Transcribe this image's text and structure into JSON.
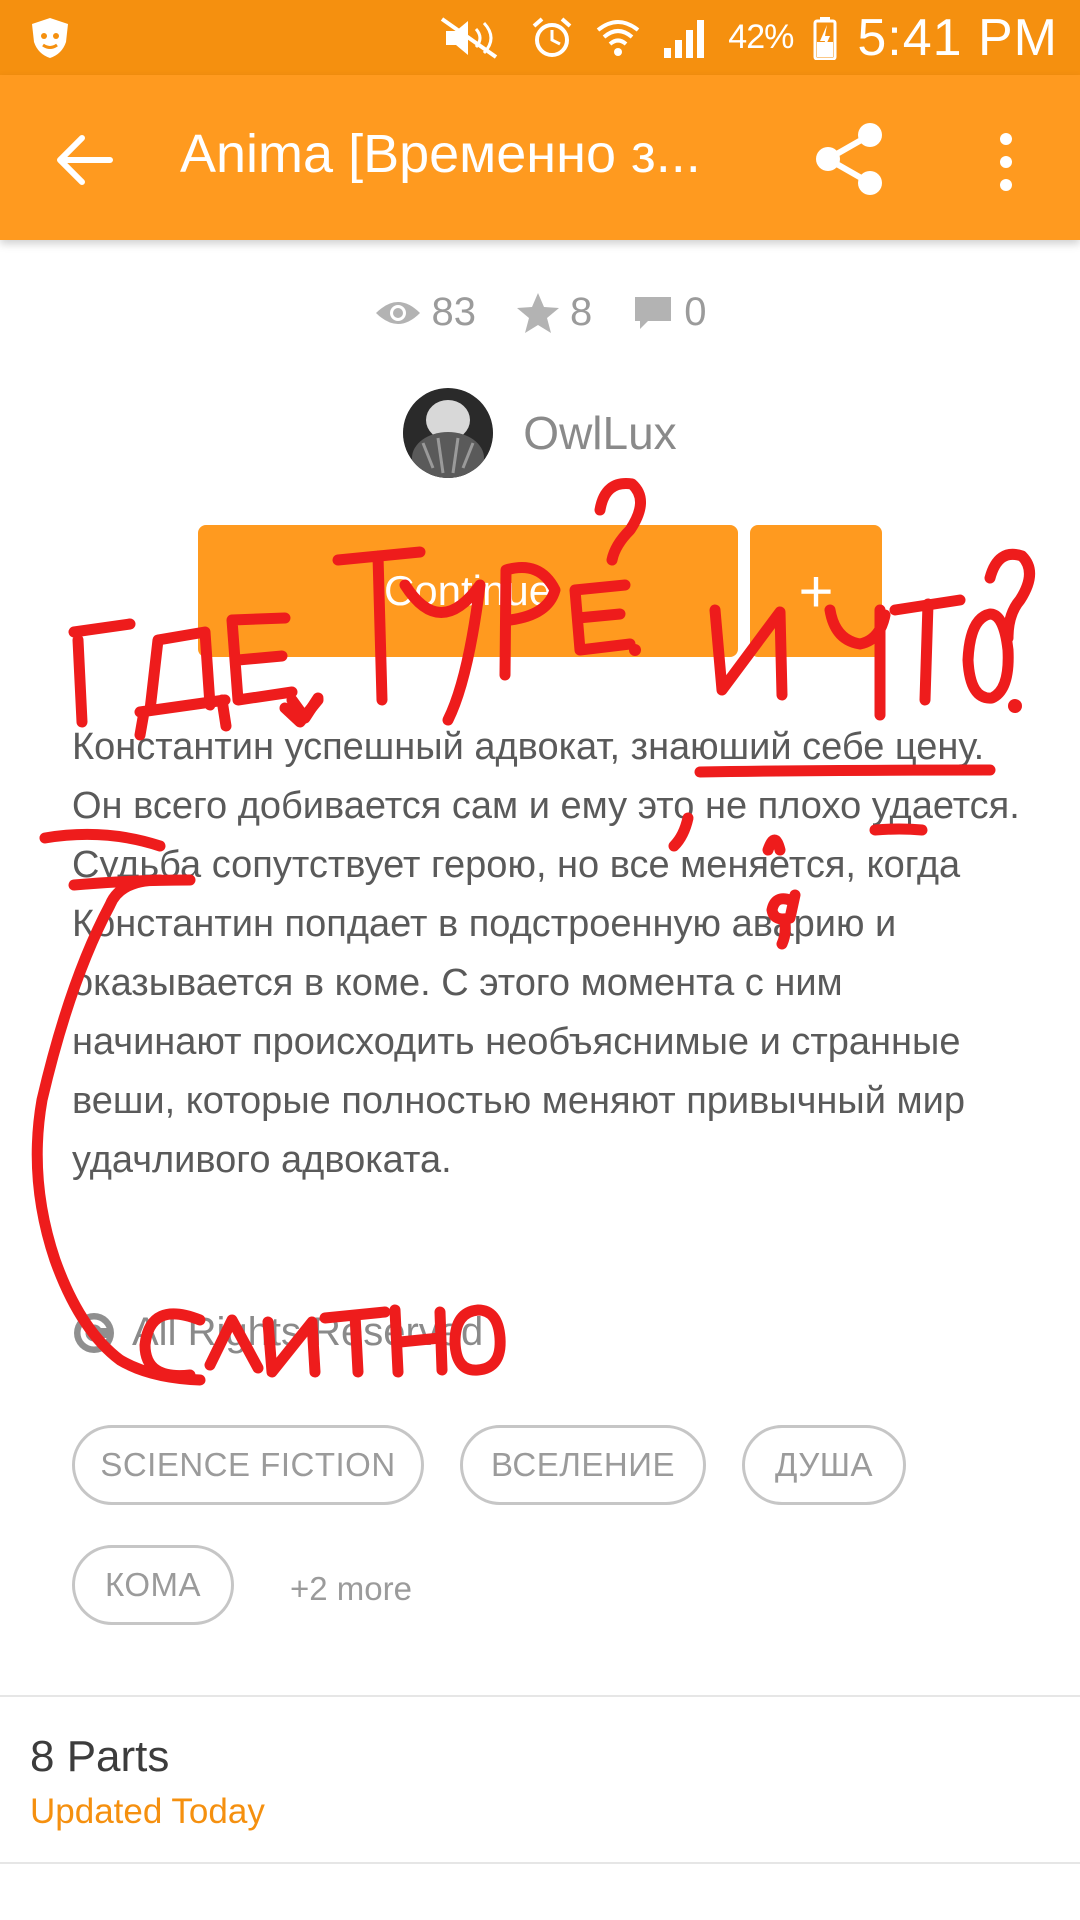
{
  "status_bar": {
    "battery": "42%",
    "time": "5:41 PM"
  },
  "app_bar": {
    "title": "Anima [Временно з...",
    "back_icon": "arrow-left-icon",
    "share_icon": "share-icon",
    "more_icon": "more-vert-icon"
  },
  "stats": {
    "views": "83",
    "votes": "8",
    "comments": "0"
  },
  "author": {
    "name": "OwlLux"
  },
  "actions": {
    "continue_label": "Continue",
    "add_label": "+"
  },
  "description": "Константин успешный адвокат, знаюший себе цену. Он всего добивается сам и ему это не плохо удается. Судьба сопутствует герою, но все меняется, когда Константин попдает в подстроенную аварию и оказывается в коме. С этого момента с ним начинают происходить необъяснимые и странные веши, которые полностью меняют привычный мир удачливого адвоката.",
  "rights": {
    "label": "All Rights Reserved"
  },
  "tags": [
    "SCIENCE FICTION",
    "ВСЕЛЕНИЕ",
    "ДУША",
    "КОМА"
  ],
  "more_tags": "+2 more",
  "parts": {
    "count_label": "8 Parts",
    "updated_label": "Updated Today"
  },
  "handwritten_annotations": {
    "top_left": "ГДЕ ТИРЕ?",
    "top_right": "И ЧТО?",
    "bottom": "СЛИТНО"
  },
  "colors": {
    "status_bar": "#f5900f",
    "app_bar": "#ff9a1f",
    "accent": "#f5900f",
    "annotation_red": "#ee1c1c"
  }
}
